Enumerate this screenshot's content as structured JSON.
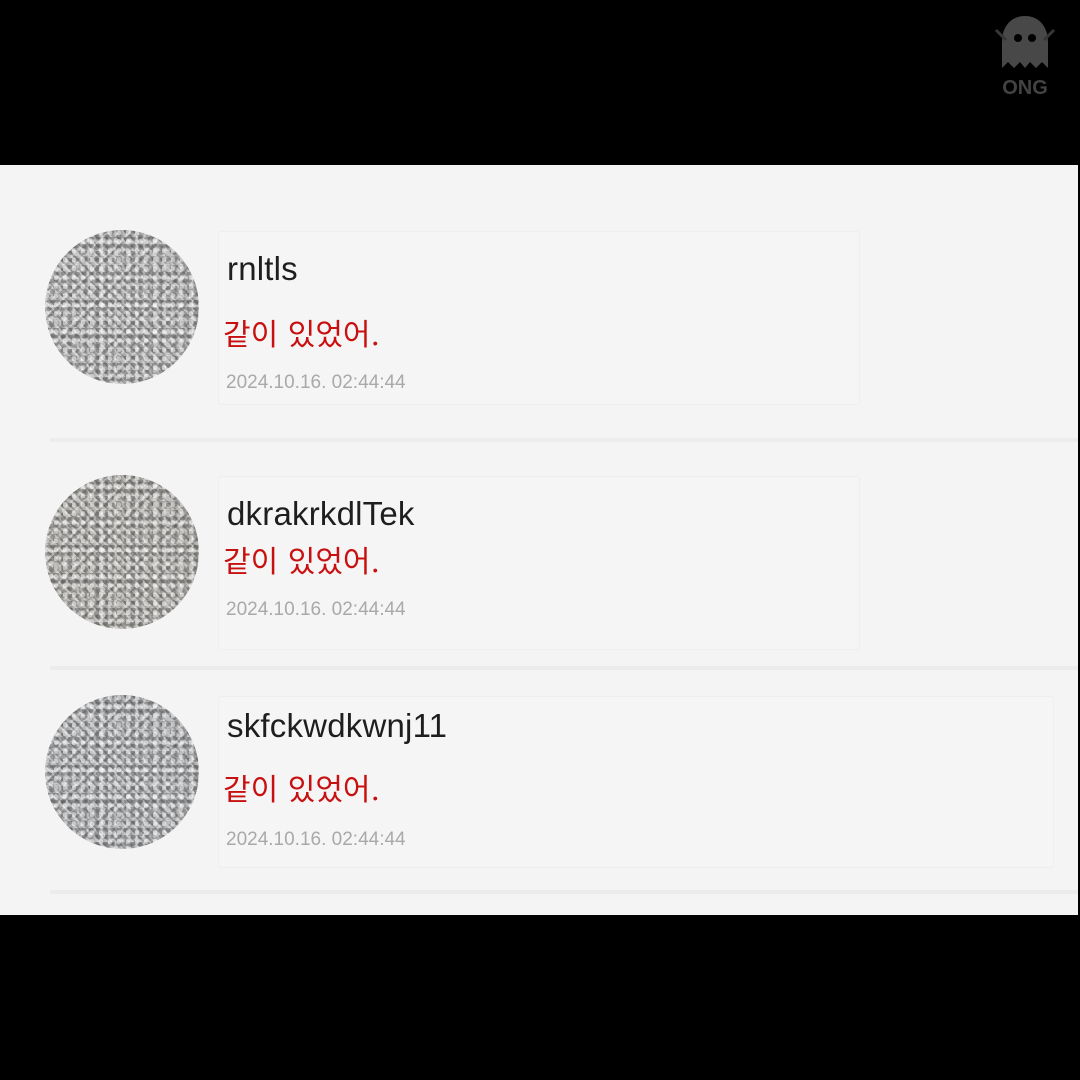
{
  "watermark": {
    "icon": "ghost-logo-icon",
    "text": "ONG"
  },
  "comments": [
    {
      "username": "rnltls",
      "message": "같이 있었어.",
      "timestamp": "2024.10.16. 02:44:44",
      "avatar_icon": "blurred-avatar"
    },
    {
      "username": "dkrakrkdlTek",
      "message": "같이 있었어.",
      "timestamp": "2024.10.16. 02:44:44",
      "avatar_icon": "blurred-avatar"
    },
    {
      "username": "skfckwdkwnj11",
      "message": "같이 있었어.",
      "timestamp": "2024.10.16. 02:44:44",
      "avatar_icon": "blurred-avatar"
    }
  ],
  "colors": {
    "message_text": "#c81010",
    "username_text": "#1e1e1e",
    "timestamp_text": "#a9a9a9",
    "panel_background": "#f4f4f4",
    "frame_background": "#000000"
  }
}
